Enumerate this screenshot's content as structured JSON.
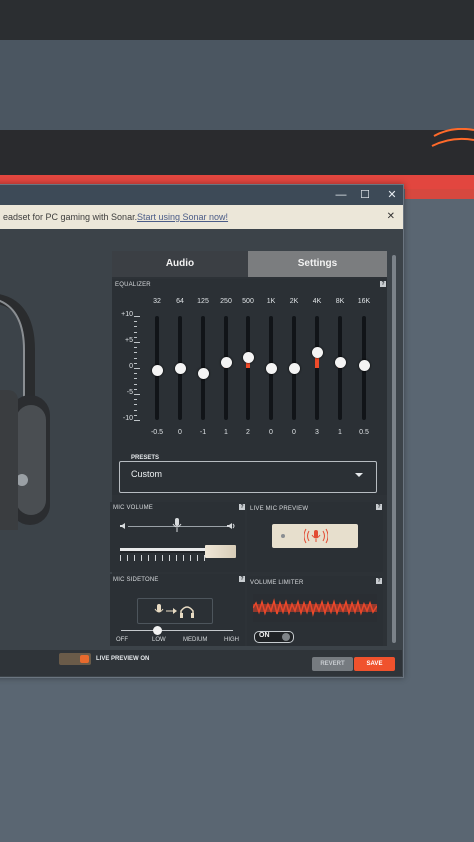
{
  "banner": {
    "text": "eadset for PC gaming with Sonar.",
    "link": "Start using Sonar now!",
    "close": "✕"
  },
  "window_controls": {
    "minimize": "—",
    "maximize": "☐",
    "close": "✕"
  },
  "tabs": [
    {
      "label": "Audio",
      "active": true
    },
    {
      "label": "Settings",
      "active": false
    }
  ],
  "equalizer": {
    "label": "EQUALIZER",
    "db_labels": [
      "+10",
      "+5",
      "0",
      "-5",
      "-10"
    ],
    "bands": [
      {
        "freq": "32",
        "gain": "-0.5",
        "value": -0.5
      },
      {
        "freq": "64",
        "gain": "0",
        "value": 0
      },
      {
        "freq": "125",
        "gain": "-1",
        "value": -1
      },
      {
        "freq": "250",
        "gain": "1",
        "value": 1
      },
      {
        "freq": "500",
        "gain": "2",
        "value": 2
      },
      {
        "freq": "1K",
        "gain": "0",
        "value": 0
      },
      {
        "freq": "2K",
        "gain": "0",
        "value": 0
      },
      {
        "freq": "4K",
        "gain": "3",
        "value": 3
      },
      {
        "freq": "8K",
        "gain": "1",
        "value": 1
      },
      {
        "freq": "16K",
        "gain": "0.5",
        "value": 0.5
      }
    ],
    "range": [
      -10,
      10
    ]
  },
  "presets": {
    "label": "PRESETS",
    "value": "Custom"
  },
  "mic_volume": {
    "label": "MIC VOLUME",
    "level": 0.75
  },
  "live_mic_preview": {
    "label": "LIVE MIC PREVIEW"
  },
  "mic_sidetone": {
    "label": "MIC SIDETONE",
    "stops": [
      "OFF",
      "LOW",
      "MEDIUM",
      "HIGH"
    ],
    "selected": "LOW"
  },
  "volume_limiter": {
    "label": "VOLUME LIMITER",
    "toggle": "ON"
  },
  "footer": {
    "live_preview": "LIVE PREVIEW ON",
    "revert": "REVERT",
    "save": "SAVE"
  },
  "colors": {
    "accent": "#f0522d",
    "panel": "#2b3035"
  },
  "help_icon": "?"
}
